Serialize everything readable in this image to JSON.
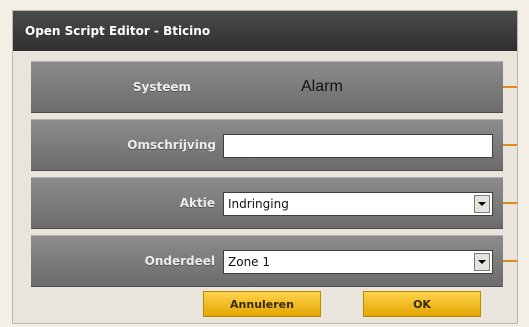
{
  "window": {
    "title": "Open Script Editor - Bticino"
  },
  "form": {
    "systeem": {
      "label": "Systeem",
      "value": "Alarm"
    },
    "omschrijving": {
      "label": "Omschrijving",
      "value": ""
    },
    "aktie": {
      "label": "Aktie",
      "value": "Indringing"
    },
    "onderdeel": {
      "label": "Onderdeel",
      "value": "Zone 1"
    }
  },
  "buttons": {
    "cancel": "Annuleren",
    "ok": "OK"
  },
  "colors": {
    "accent": "#e08a1a",
    "button": "#f0be2a",
    "titlebar": "#3a3a3a",
    "row": "#7a7a7a"
  }
}
